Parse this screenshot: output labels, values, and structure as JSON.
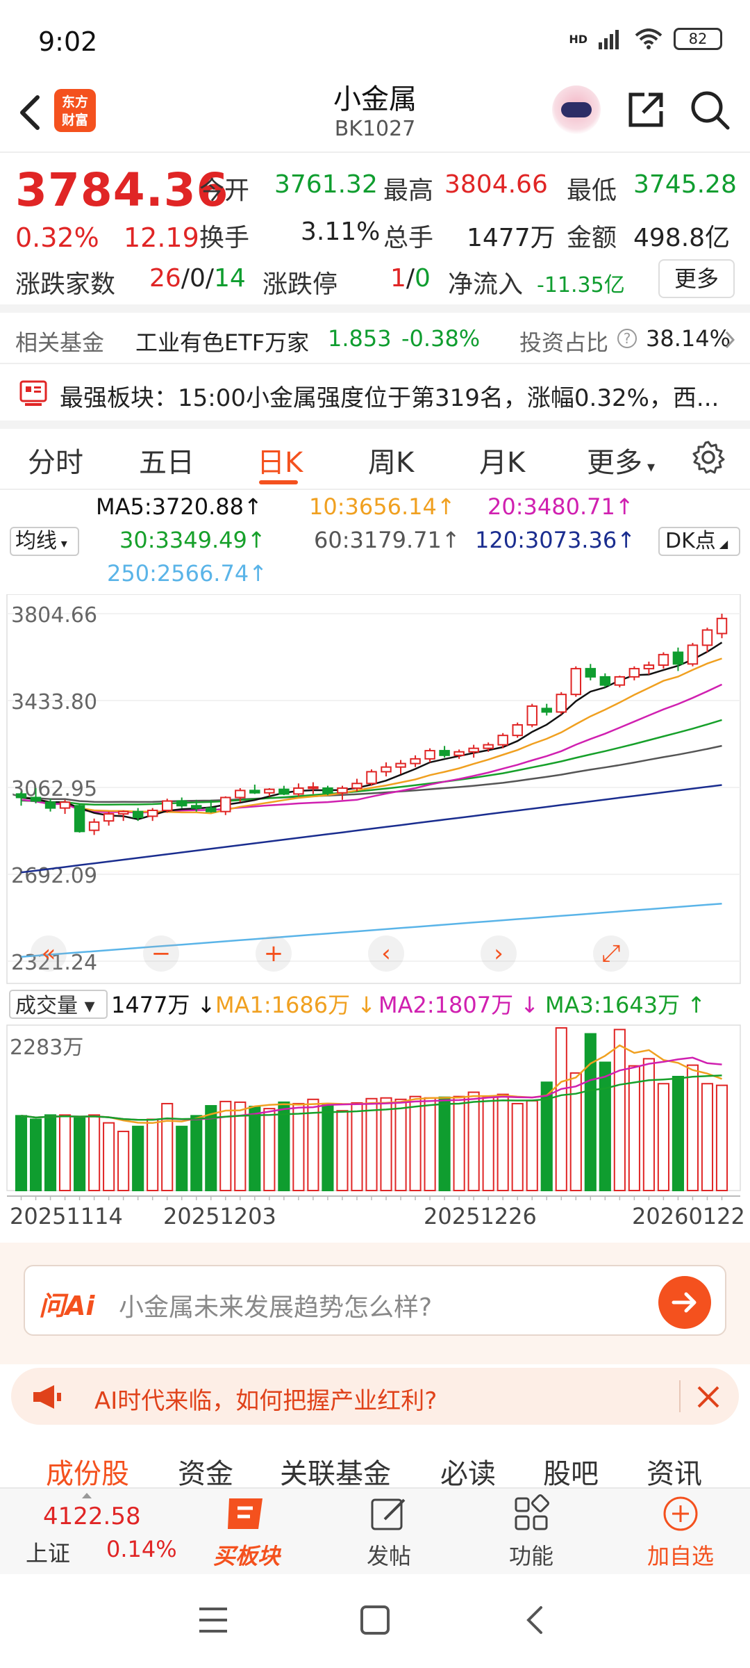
{
  "status_bar": {
    "time": "9:02",
    "battery": "82",
    "network": "HD"
  },
  "header": {
    "title": "小金属",
    "code": "BK1027",
    "logo_line1": "东方",
    "logo_line2": "财富"
  },
  "quote": {
    "price": "3784.36",
    "change_pct": "0.32%",
    "change_amt": "12.19",
    "open_label": "今开",
    "open": "3761.32",
    "high_label": "最高",
    "high": "3804.66",
    "low_label": "最低",
    "low": "3745.28",
    "turnover_label": "换手",
    "turnover": "3.11%",
    "volume_label": "总手",
    "volume": "1477万",
    "amount_label": "金额",
    "amount": "498.8亿",
    "updown_label": "涨跌家数",
    "up_count": "26",
    "flat_count": "0",
    "down_count": "14",
    "limit_label": "涨跌停",
    "limit_up": "1",
    "limit_down": "0",
    "netflow_label": "净流入",
    "netflow": "-11.35亿",
    "more_button": "更多"
  },
  "fund": {
    "label": "相关基金",
    "name": "工业有色ETF万家",
    "price": "1.853",
    "change": "-0.38%",
    "ratio_label": "投资占比",
    "ratio": "38.14%"
  },
  "strongest": {
    "text": "最强板块：15:00小金属强度位于第319名，涨幅0.32%，西..."
  },
  "tabs": [
    "分时",
    "五日",
    "日K",
    "周K",
    "月K",
    "更多"
  ],
  "active_tab": "日K",
  "ma": {
    "ma5": "MA5:3720.88",
    "ma10": "10:3656.14",
    "ma20": "20:3480.71",
    "ma30": "30:3349.49",
    "ma60": "60:3179.71",
    "ma120": "120:3073.36",
    "ma250": "250:2566.74",
    "avg_select": "均线",
    "dk_select": "DK点"
  },
  "colors": {
    "up": "#e02525",
    "down": "#0f9d2f",
    "ma5": "#111111",
    "ma10": "#f0a020",
    "ma20": "#d020b0",
    "ma30": "#16a02a",
    "ma60": "#555555",
    "ma120": "#1a2d8f",
    "ma250": "#5ab4e8",
    "accent": "#f4511e"
  },
  "chart_data": {
    "type": "candlestick",
    "y_ticks": [
      "3804.66",
      "3433.80",
      "3062.95",
      "2692.09",
      "2321.24"
    ],
    "ylim": [
      2321.24,
      3804.66
    ],
    "dates": [
      "20251114",
      "20251203",
      "20251226",
      "20260122"
    ],
    "candles_ohlc": [
      [
        3035,
        3045,
        2985,
        3020
      ],
      [
        3020,
        3060,
        2995,
        3005
      ],
      [
        3000,
        3015,
        2960,
        2975
      ],
      [
        2975,
        3010,
        2950,
        3000
      ],
      [
        2985,
        2995,
        2870,
        2875
      ],
      [
        2880,
        2930,
        2860,
        2915
      ],
      [
        2920,
        2960,
        2900,
        2950
      ],
      [
        2950,
        2965,
        2920,
        2960
      ],
      [
        2960,
        2975,
        2920,
        2935
      ],
      [
        2940,
        2975,
        2920,
        2965
      ],
      [
        2965,
        3015,
        2955,
        3005
      ],
      [
        3005,
        3020,
        2975,
        2985
      ],
      [
        2985,
        3010,
        2960,
        2975
      ],
      [
        2975,
        3010,
        2955,
        2960
      ],
      [
        2960,
        3025,
        2945,
        3020
      ],
      [
        3020,
        3060,
        3000,
        3050
      ],
      [
        3050,
        3075,
        3035,
        3040
      ],
      [
        3040,
        3060,
        3025,
        3055
      ],
      [
        3055,
        3070,
        3030,
        3035
      ],
      [
        3035,
        3080,
        3025,
        3060
      ],
      [
        3060,
        3085,
        3035,
        3065
      ],
      [
        3060,
        3070,
        3030,
        3040
      ],
      [
        3040,
        3070,
        3010,
        3060
      ],
      [
        3060,
        3100,
        3045,
        3080
      ],
      [
        3080,
        3140,
        3070,
        3130
      ],
      [
        3130,
        3170,
        3110,
        3150
      ],
      [
        3150,
        3180,
        3120,
        3165
      ],
      [
        3165,
        3200,
        3150,
        3185
      ],
      [
        3185,
        3230,
        3170,
        3220
      ],
      [
        3220,
        3240,
        3190,
        3200
      ],
      [
        3200,
        3225,
        3185,
        3215
      ],
      [
        3215,
        3245,
        3190,
        3230
      ],
      [
        3230,
        3255,
        3215,
        3245
      ],
      [
        3245,
        3295,
        3230,
        3285
      ],
      [
        3285,
        3340,
        3275,
        3330
      ],
      [
        3330,
        3420,
        3320,
        3410
      ],
      [
        3400,
        3420,
        3370,
        3385
      ],
      [
        3385,
        3470,
        3375,
        3460
      ],
      [
        3460,
        3580,
        3450,
        3570
      ],
      [
        3570,
        3590,
        3520,
        3535
      ],
      [
        3535,
        3550,
        3490,
        3500
      ],
      [
        3500,
        3540,
        3490,
        3535
      ],
      [
        3535,
        3580,
        3520,
        3570
      ],
      [
        3570,
        3600,
        3545,
        3585
      ],
      [
        3585,
        3640,
        3570,
        3630
      ],
      [
        3640,
        3660,
        3560,
        3590
      ],
      [
        3590,
        3680,
        3580,
        3670
      ],
      [
        3670,
        3745,
        3640,
        3735
      ],
      [
        3720,
        3804.66,
        3700,
        3784.36
      ]
    ],
    "ma_values": {
      "ma5": "3720.88",
      "ma10": "3656.14",
      "ma20": "3480.71",
      "ma30": "3349.49",
      "ma60": "3179.71",
      "ma120": "3073.36",
      "ma250": "2566.74"
    },
    "volume": {
      "label": "成交量",
      "current": "1477万",
      "ma1": "MA1:1686万",
      "ma2": "MA2:1807万",
      "ma3": "MA3:1643万",
      "ymax_label": "2283万",
      "ymax": 2283,
      "bars": [
        1050,
        1000,
        1060,
        1060,
        1020,
        1060,
        950,
        830,
        900,
        1000,
        1220,
        900,
        1050,
        1190,
        1250,
        1240,
        1180,
        1150,
        1240,
        1220,
        1280,
        1220,
        1120,
        1230,
        1290,
        1300,
        1280,
        1320,
        1300,
        1310,
        1320,
        1380,
        1320,
        1350,
        1220,
        1260,
        1520,
        2283,
        1650,
        2200,
        1800,
        2260,
        1750,
        1850,
        1500,
        1600,
        1760,
        1500,
        1477
      ]
    }
  },
  "ask_ai": {
    "logo": "问Ai",
    "placeholder": "小金属未来发展趋势怎么样?"
  },
  "promo": {
    "text": "AI时代来临，如何把握产业红利?"
  },
  "subtabs": [
    "成份股",
    "资金",
    "关联基金",
    "必读",
    "股吧",
    "资讯"
  ],
  "bottom_bar": {
    "index_value": "4122.58",
    "index_name": "上证",
    "index_change": "0.14%",
    "buy_label": "买板块",
    "post_label": "发帖",
    "func_label": "功能",
    "add_label": "加自选"
  }
}
